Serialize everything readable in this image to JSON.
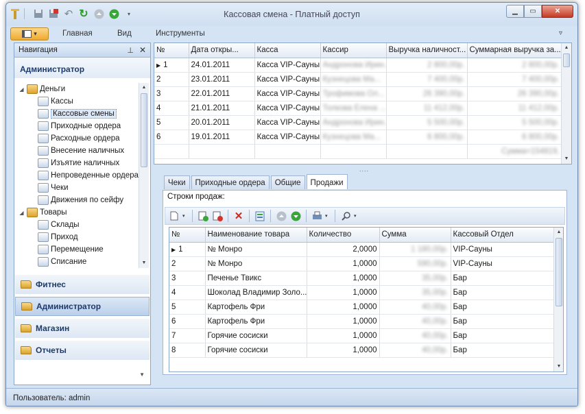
{
  "window": {
    "title": "Кассовая смена - Платный доступ"
  },
  "ribbon": {
    "tabs": [
      "Главная",
      "Вид",
      "Инструменты"
    ]
  },
  "nav": {
    "header": "Навигация",
    "title": "Администратор",
    "tree": [
      {
        "label": "Деньги",
        "level": 0,
        "expanded": true
      },
      {
        "label": "Кассы",
        "level": 1
      },
      {
        "label": "Кассовые смены",
        "level": 1,
        "selected": true
      },
      {
        "label": "Приходные ордера",
        "level": 1
      },
      {
        "label": "Расходные ордера",
        "level": 1
      },
      {
        "label": "Внесение наличных",
        "level": 1
      },
      {
        "label": "Изъятие наличных",
        "level": 1
      },
      {
        "label": "Непроведенные ордера",
        "level": 1
      },
      {
        "label": "Чеки",
        "level": 1
      },
      {
        "label": "Движения по сейфу",
        "level": 1
      },
      {
        "label": "Товары",
        "level": 0,
        "expanded": true
      },
      {
        "label": "Склады",
        "level": 1
      },
      {
        "label": "Приход",
        "level": 1
      },
      {
        "label": "Перемещение",
        "level": 1
      },
      {
        "label": "Списание",
        "level": 1
      }
    ],
    "groups": [
      {
        "label": "Фитнес",
        "active": false
      },
      {
        "label": "Администратор",
        "active": true
      },
      {
        "label": "Магазин",
        "active": false
      },
      {
        "label": "Отчеты",
        "active": false
      }
    ]
  },
  "shifts": {
    "columns": [
      "№",
      "Дата откры...",
      "Касса",
      "Кассир",
      "Выручка наличност...",
      "Суммарная выручка за..."
    ],
    "rows": [
      {
        "n": "1",
        "date": "24.01.2011",
        "kassa": "Касса VIP-Сауны",
        "cashier": "Андронова Ирин...",
        "cash": "2 800,00р.",
        "total": "2 800,00р."
      },
      {
        "n": "2",
        "date": "23.01.2011",
        "kassa": "Касса VIP-Сауны",
        "cashier": "Кузнецова Ма...",
        "cash": "7 400,00р.",
        "total": "7 400,00р."
      },
      {
        "n": "3",
        "date": "22.01.2011",
        "kassa": "Касса VIP-Сауны",
        "cashier": "Трофимова Ол...",
        "cash": "26 390,00р.",
        "total": "26 390,00р."
      },
      {
        "n": "4",
        "date": "21.01.2011",
        "kassa": "Касса VIP-Сауны",
        "cashier": "Толкова Елена ...",
        "cash": "11 412,00р.",
        "total": "11 412,00р."
      },
      {
        "n": "5",
        "date": "20.01.2011",
        "kassa": "Касса VIP-Сауны",
        "cashier": "Андронова Ирин...",
        "cash": "5 500,00р.",
        "total": "5 500,00р."
      },
      {
        "n": "6",
        "date": "19.01.2011",
        "kassa": "Касса VIP-Сауны",
        "cashier": "Кузнецова Ма...",
        "cash": "6 800,00р.",
        "total": "6 800,00р."
      }
    ],
    "footer_sum": "Сумма=154819,"
  },
  "detail": {
    "tabs": [
      "Чеки",
      "Приходные ордера",
      "Общие",
      "Продажи"
    ],
    "active_tab": "Продажи",
    "label": "Строки продаж:",
    "columns": [
      "№",
      "Наименование товара",
      "Количество",
      "Сумма",
      "Кассовый Отдел"
    ],
    "rows": [
      {
        "n": "1",
        "name": "№ Монро",
        "qty": "2,0000",
        "sum": "1 180,00р.",
        "dept": "VIP-Сауны"
      },
      {
        "n": "2",
        "name": "№ Монро",
        "qty": "1,0000",
        "sum": "590,00р.",
        "dept": "VIP-Сауны"
      },
      {
        "n": "3",
        "name": "Печенье Твикс",
        "qty": "1,0000",
        "sum": "35,00р.",
        "dept": "Бар"
      },
      {
        "n": "4",
        "name": "Шоколад Владимир Золо...",
        "qty": "1,0000",
        "sum": "35,00р.",
        "dept": "Бар"
      },
      {
        "n": "5",
        "name": "Картофель Фри",
        "qty": "1,0000",
        "sum": "40,00р.",
        "dept": "Бар"
      },
      {
        "n": "6",
        "name": "Картофель Фри",
        "qty": "1,0000",
        "sum": "40,00р.",
        "dept": "Бар"
      },
      {
        "n": "7",
        "name": "Горячие сосиски",
        "qty": "1,0000",
        "sum": "40,00р.",
        "dept": "Бар"
      },
      {
        "n": "8",
        "name": "Горячие сосиски",
        "qty": "1,0000",
        "sum": "40,00р.",
        "dept": "Бар"
      }
    ]
  },
  "status": {
    "text": "Пользователь: admin"
  }
}
